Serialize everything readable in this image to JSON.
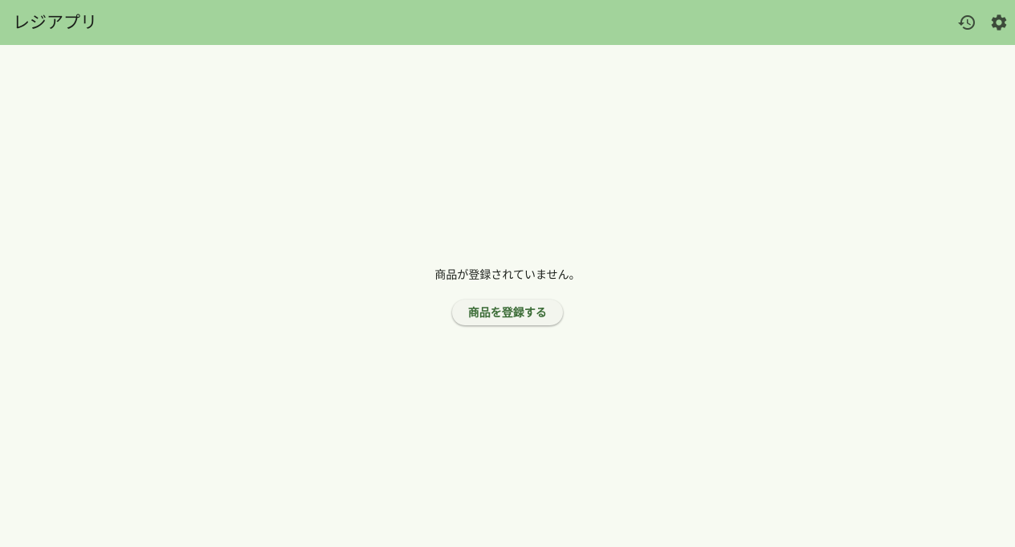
{
  "app": {
    "title": "レジアプリ"
  },
  "toolbar": {
    "history_icon": "history-icon",
    "settings_icon": "gear-icon"
  },
  "empty_state": {
    "message": "商品が登録されていません。",
    "register_button_label": "商品を登録する"
  },
  "colors": {
    "appbar_background": "#A2D39B",
    "page_background": "#F7FAF2",
    "button_text": "#3A6B35",
    "icon_color": "#3C4A3A"
  }
}
